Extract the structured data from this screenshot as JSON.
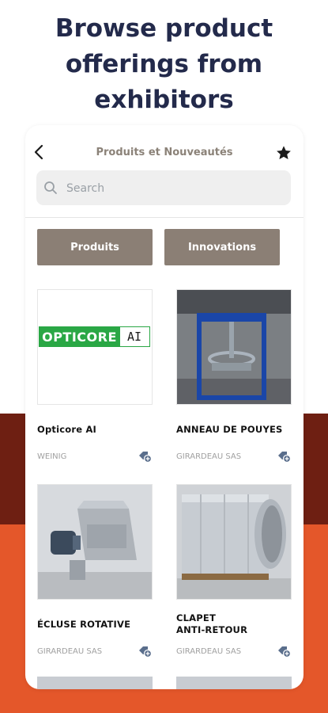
{
  "headline": [
    "Browse product",
    "offerings from",
    "exhibitors"
  ],
  "app": {
    "title": "Produits et Nouveautés",
    "search_placeholder": "Search",
    "tabs": [
      "Produits",
      "Innovations"
    ]
  },
  "products": [
    {
      "name": "Opticore AI",
      "exhibitor": "WEINIG",
      "logo_text": "OPTICORE",
      "logo_suffix": "AI"
    },
    {
      "name": "ANNEAU DE POUYES",
      "exhibitor": "GIRARDEAU SAS"
    },
    {
      "name": "ÉCLUSE ROTATIVE",
      "exhibitor": "GIRARDEAU SAS"
    },
    {
      "name": "CLAPET\nANTI-RETOUR",
      "exhibitor": "GIRARDEAU SAS"
    }
  ],
  "colors": {
    "headline": "#232a4b",
    "tab_bg": "#8b7f75",
    "band_dark": "#6e1f12",
    "band_orange": "#e4572a",
    "logo_green": "#2aa745"
  },
  "icons": [
    "back-icon",
    "star-icon",
    "search-icon",
    "add-favorite-exhibitor-icon"
  ]
}
